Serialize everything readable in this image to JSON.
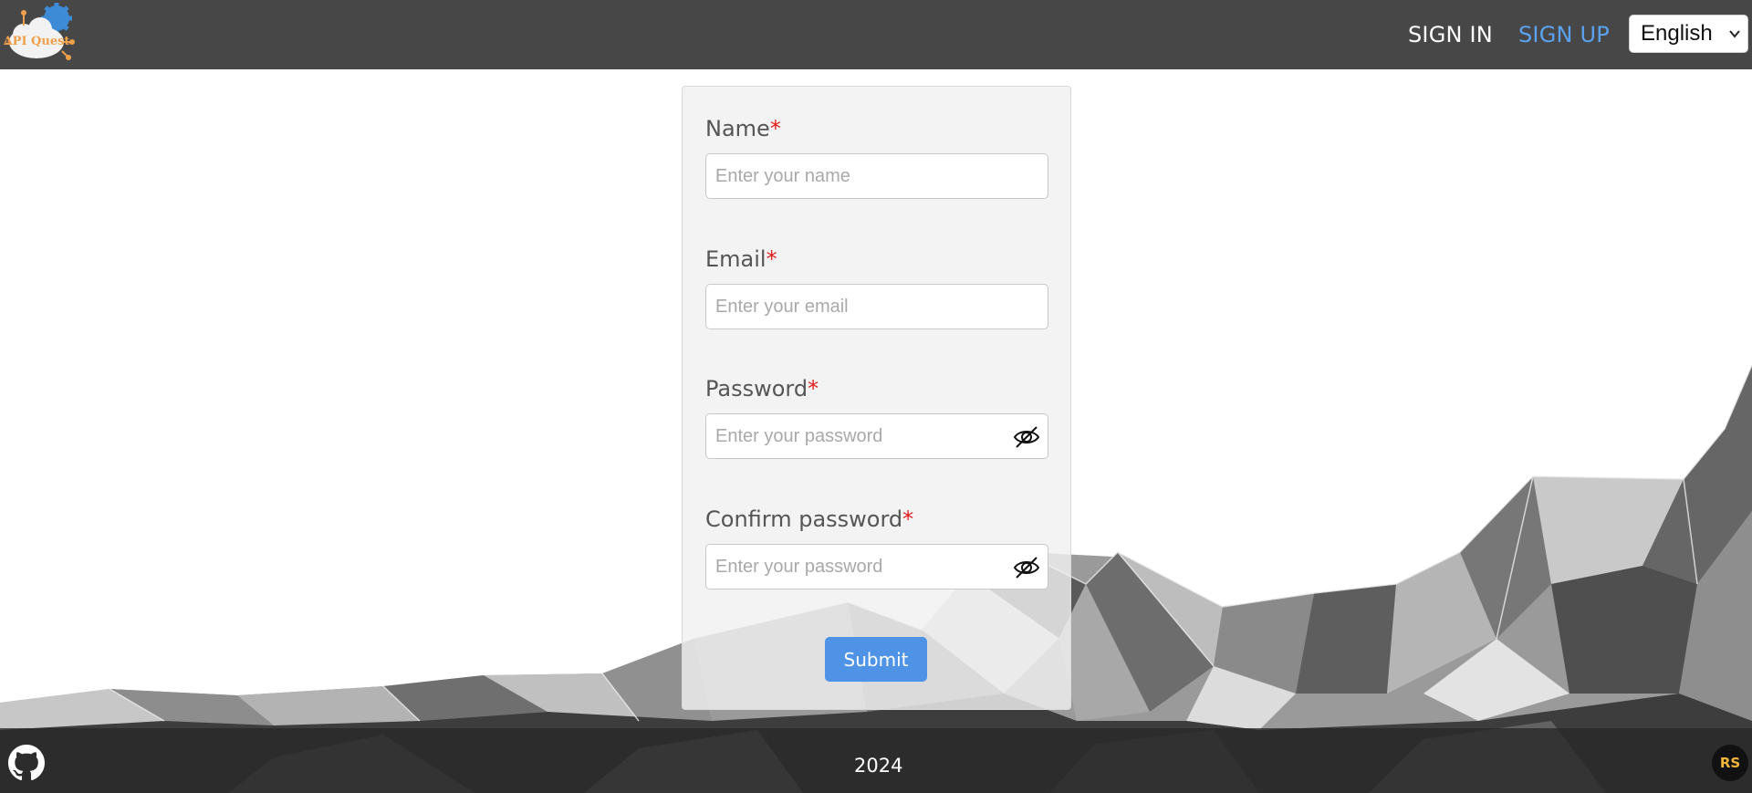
{
  "header": {
    "logo_text": "API Quest",
    "nav": {
      "sign_in": "SIGN IN",
      "sign_up": "SIGN UP"
    },
    "language": {
      "selected": "English"
    }
  },
  "form": {
    "name": {
      "label": "Name",
      "required_mark": "*",
      "placeholder": "Enter your name",
      "value": ""
    },
    "email": {
      "label": "Email",
      "required_mark": "*",
      "placeholder": "Enter your email",
      "value": ""
    },
    "password": {
      "label": "Password",
      "required_mark": "*",
      "placeholder": "Enter your password",
      "value": ""
    },
    "confirm_password": {
      "label": "Confirm password",
      "required_mark": "*",
      "placeholder": "Enter your password",
      "value": ""
    },
    "submit_label": "Submit"
  },
  "footer": {
    "year": "2024",
    "rs_badge": "RS",
    "github_icon": "github-icon"
  },
  "colors": {
    "header_bg": "#474747",
    "accent": "#5aa2ee",
    "button": "#4f93e6",
    "required": "#e11d1d"
  }
}
